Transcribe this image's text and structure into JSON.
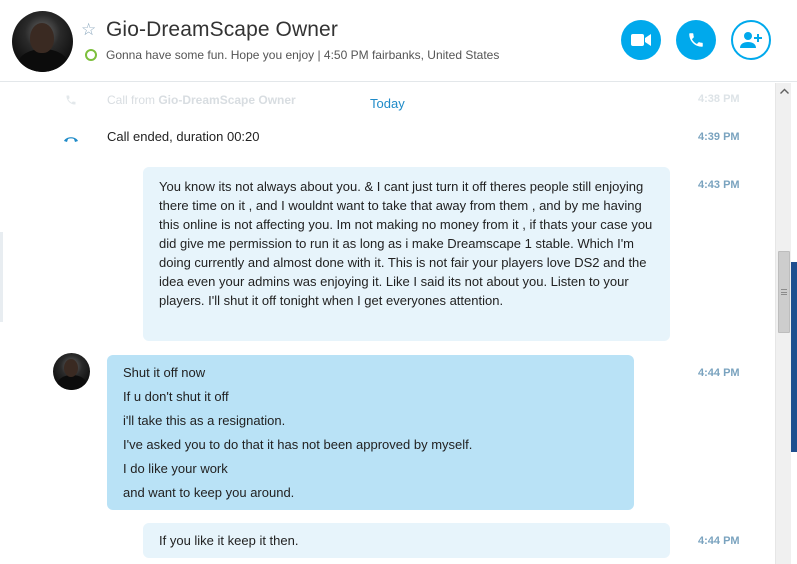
{
  "header": {
    "contact_name": "Gio-DreamScape Owner",
    "status_text": "Gonna have some fun. Hope you enjoy  |  4:50 PM fairbanks, United States",
    "buttons": {
      "video_icon": "video-camera-icon",
      "call_icon": "phone-icon",
      "add_icon": "add-person-icon"
    },
    "colors": {
      "accent": "#00a9ec",
      "online": "#7dbf3c"
    }
  },
  "conversation": {
    "faded_call_prefix": "Call from ",
    "faded_call_name": "Gio-DreamScape Owner",
    "faded_time": "4:38 PM",
    "day_divider": "Today",
    "call_ended": {
      "text": "Call ended, duration 00:20",
      "time": "4:39 PM"
    },
    "messages": [
      {
        "direction": "out",
        "time": "4:43 PM",
        "text": "You know its not always about you. & I cant just turn it off theres people still enjoying there time on it , and I wouldnt want to take that away from them , and by me having this online is not affecting you. Im not making no money from it , if thats your case you did give me permission to run it as long as i make Dreamscape 1 stable. Which I'm doing currently and almost done with it. This is not fair your players love DS2 and the idea even your admins was enjoying it. Like I said its not about you. Listen to your players. I'll shut it off tonight when I get everyones attention."
      },
      {
        "direction": "in",
        "time": "4:44 PM",
        "lines": [
          "Shut it off now",
          "If u don't shut it off",
          "i'll take this as a resignation.",
          "I've asked you to do that it has not been approved by myself.",
          "I do like your work",
          "and want to keep you around."
        ]
      },
      {
        "direction": "out",
        "time": "4:44 PM",
        "text": "If you like it keep it then."
      }
    ],
    "colors": {
      "bubble_out": "#e7f4fb",
      "bubble_in": "#b9e2f6",
      "time": "#7aa3bf",
      "link": "#1f8bc8"
    }
  }
}
